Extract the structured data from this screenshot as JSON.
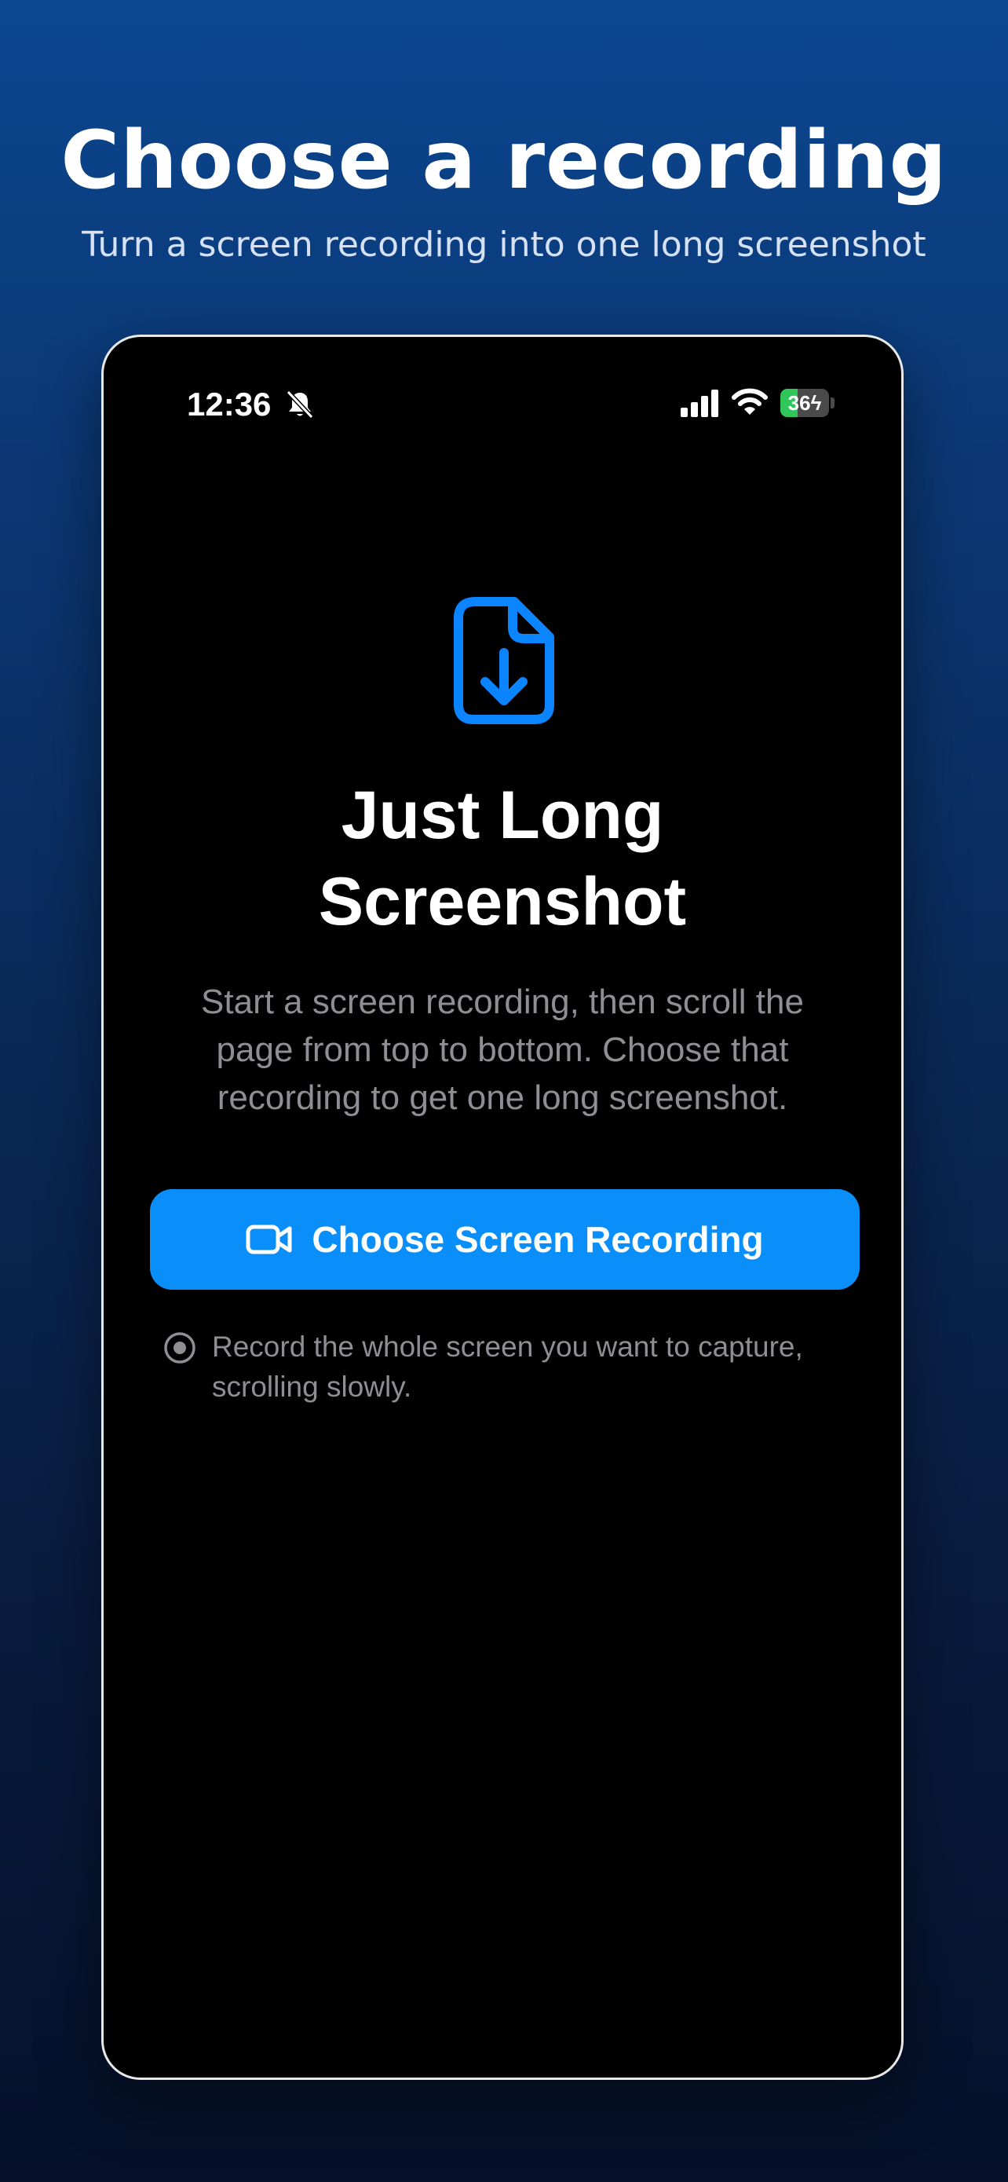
{
  "promo": {
    "title": "Choose a recording",
    "subtitle": "Turn a screen recording into one long screenshot"
  },
  "status_bar": {
    "time": "12:36",
    "battery_percent": "36",
    "battery_level": 0.36,
    "icons": [
      "bell-slash-icon",
      "cellular-signal-icon",
      "wifi-icon",
      "battery-charging-icon"
    ]
  },
  "app": {
    "icon": "file-download-icon",
    "title": "Just Long Screenshot",
    "description": "Start a screen recording, then scroll the page from top to bottom. Choose that recording to get one long screenshot.",
    "primary_button": {
      "icon": "video-camera-icon",
      "label": "Choose Screen Recording"
    },
    "hint": {
      "icon": "radio-dot-icon",
      "text": "Record the whole screen you want to capture, scrolling slowly."
    }
  },
  "colors": {
    "accent": "#0A8FFA",
    "icon_blue": "#0A84FF",
    "battery_green": "#30C75A",
    "secondary_text": "#8E8E93",
    "background_top": "#0B4690",
    "background_bottom": "#05112A"
  }
}
